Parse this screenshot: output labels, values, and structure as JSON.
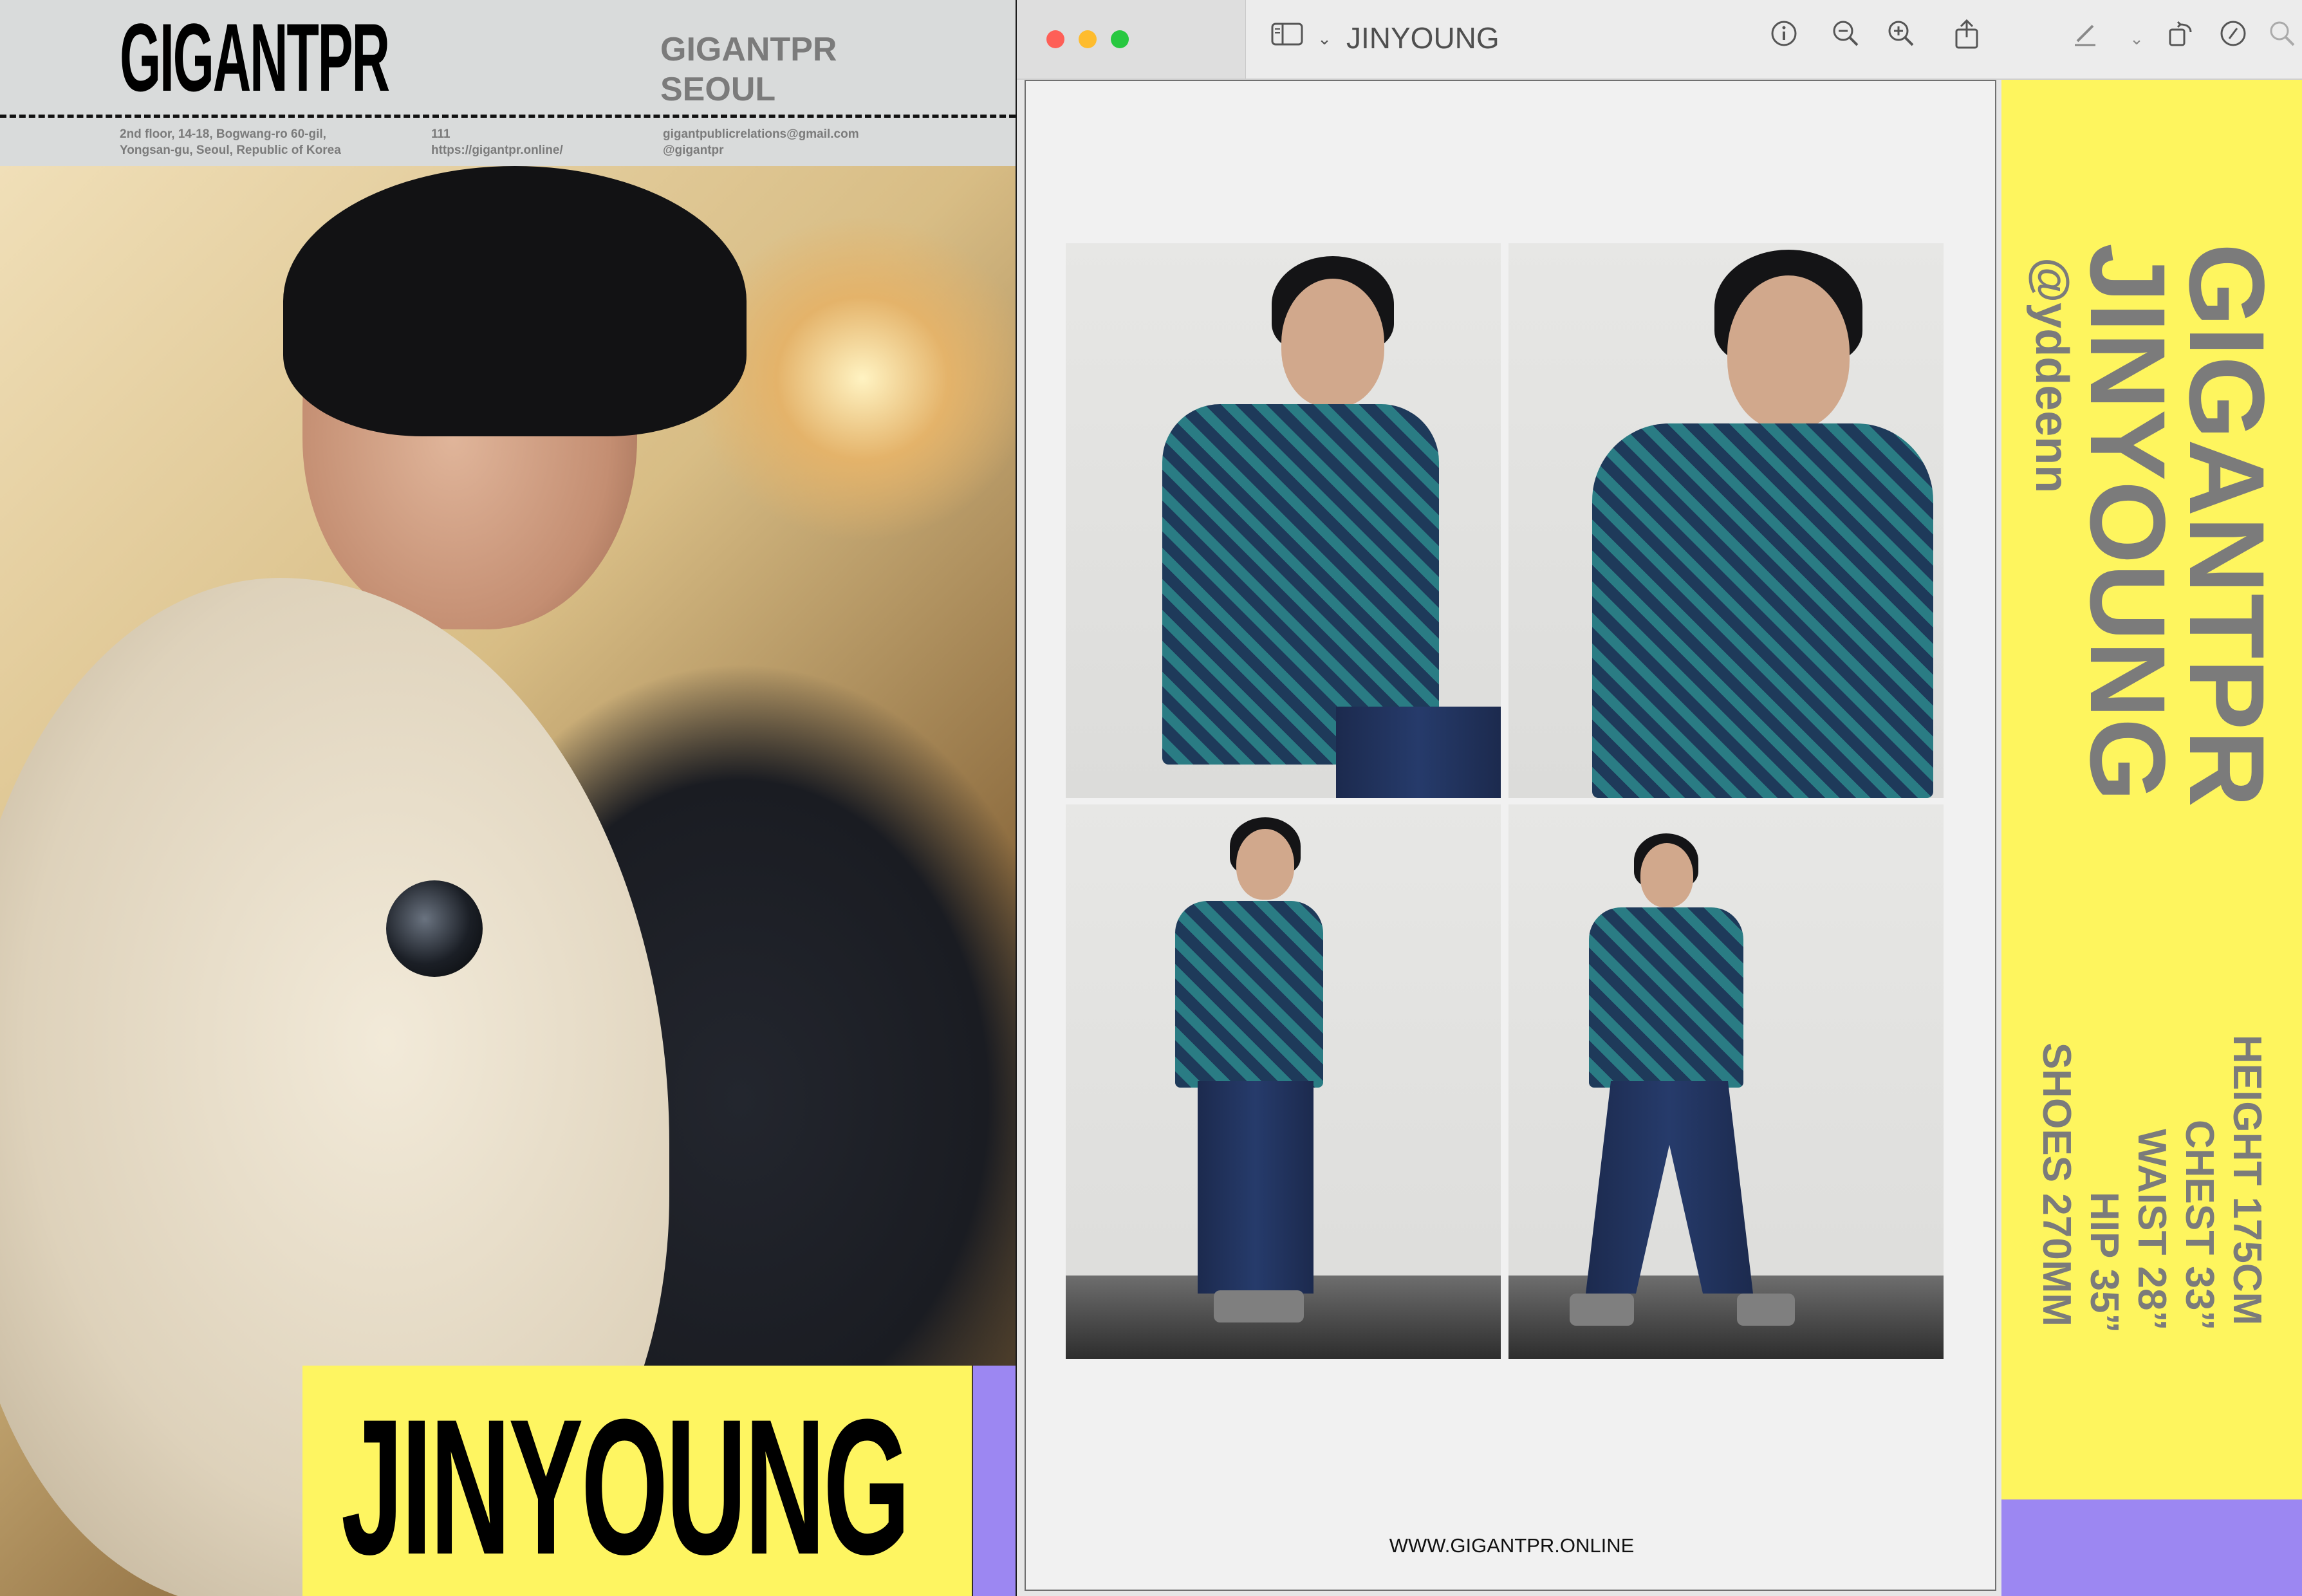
{
  "left_card": {
    "brand_logo": "GIGANTPR",
    "brand_city_line1": "GIGANTPR",
    "brand_city_line2": "SEOUL",
    "address_line1": "2nd floor, 14-18, Bogwang-ro 60-gil,",
    "address_line2": "Yongsan-gu, Seoul, Republic of Korea",
    "number": "111",
    "website": "https://gigantpr.online/",
    "email": "gigantpublicrelations@gmail.com",
    "instagram": "@gigantpr",
    "model_name": "JINYOUNG",
    "colors": {
      "banner": "#fef561",
      "accent": "#9c87f2",
      "header_bg": "#d9dbdb",
      "text_gray": "#7b7b7b"
    }
  },
  "window": {
    "title": "JINYOUNG",
    "traffic_lights": {
      "close": "#fe5f57",
      "minimize": "#febc2e",
      "zoom": "#28c840"
    },
    "toolbar": {
      "sidebar_toggle_icon": "sidebar-icon",
      "info_icon": "info-icon",
      "zoom_out_icon": "zoom-out-icon",
      "zoom_in_icon": "zoom-in-icon",
      "share_icon": "share-icon",
      "markup_icon": "pen-icon",
      "rotate_icon": "rotate-icon",
      "annotate_icon": "markup-circle-icon",
      "search_icon": "search-icon"
    },
    "page": {
      "footer_url": "WWW.GIGANTPR.ONLINE"
    },
    "side_strip": {
      "brand": "GIGANTPR",
      "name": "JINYOUNG",
      "handle": "@yddeenn",
      "stats": {
        "height": "HEIGHT 175CM",
        "chest": "CHEST 33”",
        "waist": "WAIST 28”",
        "hip": "HIP 35”",
        "shoes": "SHOES 270MM"
      },
      "colors": {
        "strip": "#fef55e",
        "accent": "#9c87f2"
      }
    }
  }
}
